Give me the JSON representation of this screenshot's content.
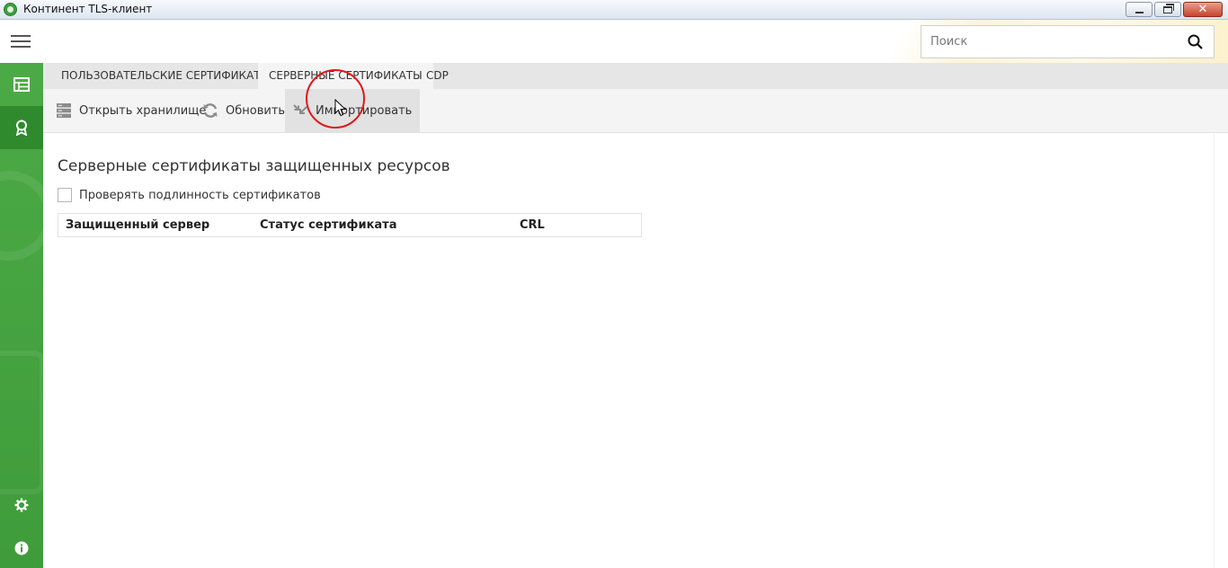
{
  "window": {
    "title": "Континент TLS-клиент"
  },
  "header": {
    "search_placeholder": "Поиск"
  },
  "sidebar": {
    "items": [
      {
        "icon": "table-icon"
      },
      {
        "icon": "certificate-icon",
        "active": true
      },
      {
        "icon": "gear-icon"
      },
      {
        "icon": "info-icon"
      }
    ]
  },
  "tabs": [
    {
      "label": "ПОЛЬЗОВАТЕЛЬСКИЕ СЕРТИФИКАТЫ"
    },
    {
      "label": "СЕРВЕРНЫЕ СЕРТИФИКАТЫ",
      "active": true
    },
    {
      "label": "CDP"
    }
  ],
  "toolbar": {
    "open_storage": "Открыть хранилище",
    "refresh": "Обновить",
    "import": "Импортировать"
  },
  "main": {
    "title": "Серверные сертификаты защищенных ресурсов",
    "verify_checkbox_label": "Проверять подлинность сертификатов",
    "verify_checked": false,
    "table": {
      "columns": [
        "Защищенный сервер",
        "Статус сертификата",
        "CRL"
      ],
      "rows": []
    }
  },
  "colors": {
    "sidebar_green": "#45a440",
    "sidebar_active": "#2f8a2d",
    "click_highlight": "#e01818"
  }
}
